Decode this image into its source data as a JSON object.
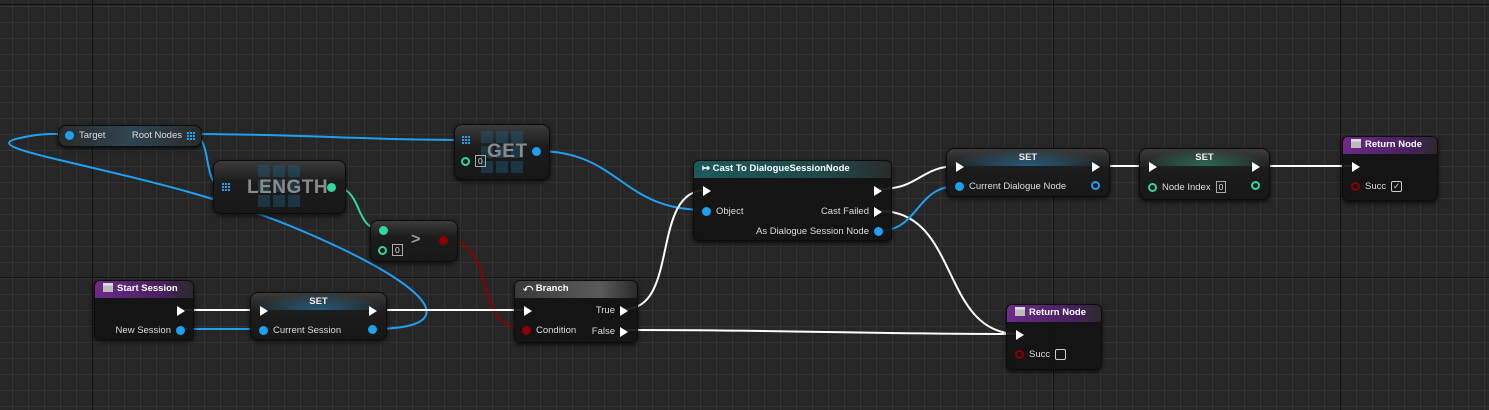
{
  "graph": {
    "var_node": {
      "target": "Target",
      "root_nodes": "Root Nodes"
    },
    "get_node": {
      "title": "GET",
      "index": "0"
    },
    "length_node": {
      "title": "LENGTH"
    },
    "greater_node": {
      "symbol": ">",
      "value": "0"
    },
    "cast_node": {
      "title": "Cast To DialogueSessionNode",
      "object": "Object",
      "cast_failed": "Cast Failed",
      "as_output": "As Dialogue Session Node"
    },
    "set_dialogue": {
      "title": "SET",
      "pin": "Current Dialogue Node"
    },
    "set_index": {
      "title": "SET",
      "pin": "Node Index",
      "value": "0"
    },
    "return_success": {
      "title": "Return Node",
      "pin": "Succ",
      "checked": true
    },
    "return_fail": {
      "title": "Return Node",
      "pin": "Succ",
      "checked": false
    },
    "start_session": {
      "title": "Start Session",
      "pin": "New Session"
    },
    "set_session": {
      "title": "SET",
      "pin": "Current Session"
    },
    "branch": {
      "title": "Branch",
      "condition": "Condition",
      "true": "True",
      "false": "False"
    }
  },
  "colors": {
    "object_pin": "#1ea0f0",
    "int_pin": "#2fd6a0",
    "bool_pin": "#8c0000",
    "exec": "#ffffff",
    "function_header": "#6c2a8a",
    "cast_header": "#1d5a5c"
  }
}
